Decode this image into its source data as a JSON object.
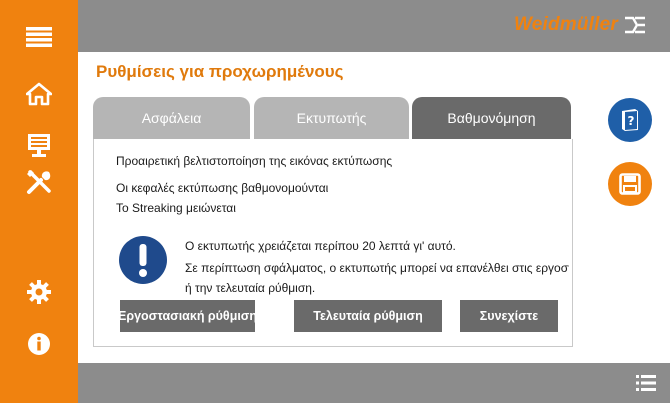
{
  "brand": {
    "name": "Weidmüller",
    "accent": "#f0820f"
  },
  "colors": {
    "sidebar": "#f0820f",
    "topbar": "#8c8c8c",
    "tab_active": "#6a6a6a",
    "tab_inactive": "#b5b5b5",
    "help_button": "#1f5fa8",
    "warning_icon": "#1f4a8c"
  },
  "sidebar": {
    "items": [
      {
        "icon": "hamburger-menu-icon"
      },
      {
        "icon": "home-icon"
      },
      {
        "icon": "printer-display-icon"
      },
      {
        "icon": "tools-icon"
      },
      {
        "icon": "gear-icon"
      },
      {
        "icon": "info-icon"
      }
    ]
  },
  "page": {
    "title": "Ρυθμίσεις για προχωρημένους"
  },
  "tabs": [
    {
      "label": "Ασφάλεια",
      "active": false
    },
    {
      "label": "Εκτυπωτής",
      "active": false
    },
    {
      "label": "Βαθμονόμηση",
      "active": true
    }
  ],
  "content": {
    "line1": "Προαιρετική βελτιστοποίηση της εικόνας εκτύπωσης",
    "line2": "Οι κεφαλές εκτύπωσης βαθμονομούνται",
    "line3": "Το Streaking μειώνεται",
    "warning": {
      "icon": "exclamation-icon",
      "line1": "Ο εκτυπωτής χρειάζεται περίπου 20 λεπτά γι' αυτό.",
      "line2": "Σε περίπτωση σφάλματος, ο εκτυπωτής μπορεί να επανέλθει στις εργοστασιακές ρυθμίσεις",
      "line3": "ή την τελευταία ρύθμιση."
    }
  },
  "buttons": {
    "factory": "Εργοστασιακή ρύθμιση",
    "last": "Τελευταία ρύθμιση",
    "continue": "Συνεχίστε"
  },
  "right_actions": [
    {
      "icon": "help-book-icon"
    },
    {
      "icon": "save-icon"
    }
  ],
  "bottom": {
    "icon": "list-menu-icon"
  }
}
